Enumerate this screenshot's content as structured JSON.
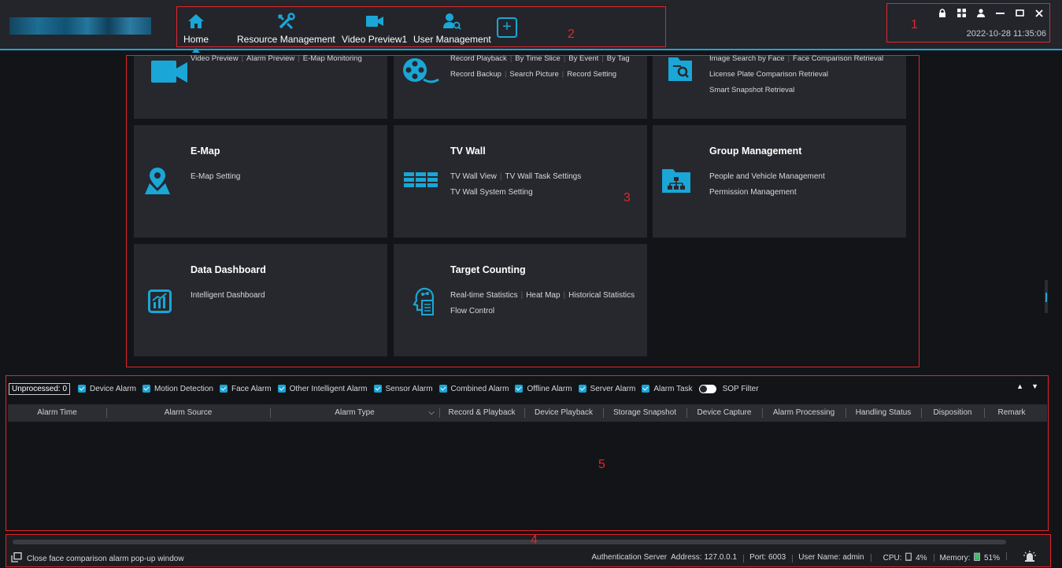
{
  "header": {
    "nav": [
      {
        "label": "Home",
        "icon": "home-icon"
      },
      {
        "label": "Resource Management",
        "icon": "tools-icon"
      },
      {
        "label": "Video Preview1",
        "icon": "camera-icon"
      },
      {
        "label": "User Management",
        "icon": "user-manage-icon"
      }
    ],
    "add_label": "+",
    "datetime": "2022-10-28 11:35:06"
  },
  "markers": {
    "m1": "1",
    "m2": "2",
    "m3": "3",
    "m4": "4",
    "m5": "5"
  },
  "tiles": {
    "live": {
      "links": [
        "Video Preview",
        "Alarm Preview",
        "E-Map Monitoring"
      ]
    },
    "record": {
      "line1": [
        "Record Playback",
        "By Time Slice",
        "By Event",
        "By Tag"
      ],
      "line2": [
        "Record Backup",
        "Search Picture",
        "Record Setting"
      ]
    },
    "search": {
      "line1": [
        "Image Search by Face",
        "Face Comparison Retrieval"
      ],
      "line2": "License Plate Comparison Retrieval",
      "line3": "Smart Snapshot Retrieval"
    },
    "emap": {
      "title": "E-Map",
      "line1": "E-Map Setting"
    },
    "tvwall": {
      "title": "TV Wall",
      "line1": [
        "TV Wall View",
        "TV Wall Task Settings"
      ],
      "line2": "TV Wall System Setting"
    },
    "group": {
      "title": "Group Management",
      "line1": "People and Vehicle Management",
      "line2": "Permission Management"
    },
    "dashboard": {
      "title": "Data Dashboard",
      "line1": "Intelligent Dashboard"
    },
    "counting": {
      "title": "Target Counting",
      "line1": [
        "Real-time Statistics",
        "Heat Map",
        "Historical Statistics"
      ],
      "line2": "Flow Control"
    }
  },
  "alarm": {
    "unprocessed": "Unprocessed: 0",
    "filters": [
      "Device Alarm",
      "Motion Detection",
      "Face Alarm",
      "Other Intelligent Alarm",
      "Sensor Alarm",
      "Combined Alarm",
      "Offline Alarm",
      "Server Alarm",
      "Alarm Task"
    ],
    "sop_label": "SOP Filter",
    "columns": [
      "Alarm Time",
      "Alarm Source",
      "Alarm Type",
      "Record & Playback",
      "Device Playback",
      "Storage Snapshot",
      "Device Capture",
      "Alarm Processing",
      "Handling Status",
      "Disposition",
      "Remark"
    ]
  },
  "status": {
    "left_text": "Close face comparison alarm pop-up window",
    "auth": "Authentication Server",
    "address": "Address: 127.0.0.1",
    "port": "Port: 6003",
    "user": "User Name: admin",
    "cpu_label": "CPU:",
    "cpu_value": "4%",
    "mem_label": "Memory:",
    "mem_value": "51%",
    "mem_level": 0.51,
    "cpu_level": 0.04
  },
  "colors": {
    "accent": "#1aa6d6",
    "highlight": "#e0262b",
    "panel": "#26282d",
    "bg": "#131418"
  }
}
